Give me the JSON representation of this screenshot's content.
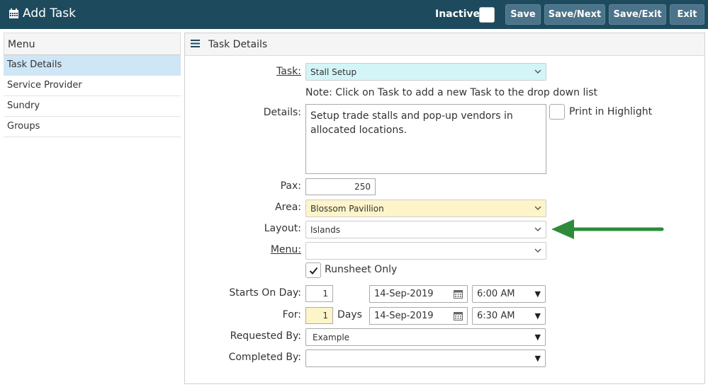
{
  "header": {
    "title": "Add Task",
    "inactive_label": "Inactive",
    "buttons": {
      "save": "Save",
      "save_next": "Save/Next",
      "save_exit": "Save/Exit",
      "exit": "Exit"
    }
  },
  "menu": {
    "header": "Menu",
    "items": [
      {
        "label": "Task Details"
      },
      {
        "label": "Service Provider"
      },
      {
        "label": "Sundry"
      },
      {
        "label": "Groups"
      }
    ]
  },
  "panel": {
    "title": "Task Details",
    "task": {
      "label": "Task:",
      "value": "Stall Setup"
    },
    "note": "Note: Click on Task to add a new Task to the drop down list",
    "details": {
      "label": "Details:",
      "value": "Setup trade stalls and pop-up vendors in allocated locations."
    },
    "print_highlight": "Print in Highlight",
    "pax": {
      "label": "Pax:",
      "value": "250"
    },
    "area": {
      "label": "Area:",
      "value": "Blossom Pavillion"
    },
    "layout": {
      "label": "Layout:",
      "value": "Islands"
    },
    "menu_field": {
      "label": "Menu:",
      "value": ""
    },
    "runsheet_only": "Runsheet Only",
    "starts_on": {
      "label": "Starts On Day:",
      "day": "1",
      "date": "14-Sep-2019",
      "time": "6:00 AM"
    },
    "for": {
      "label": "For:",
      "days_value": "1",
      "days_label": "Days",
      "date": "14-Sep-2019",
      "time": "6:30 AM"
    },
    "requested_by": {
      "label": "Requested By:",
      "value": "Example"
    },
    "completed_by": {
      "label": "Completed By:",
      "value": ""
    }
  },
  "colors": {
    "header_bg": "#1e4a5e",
    "button_bg": "#4b7389",
    "task_select_bg": "#d4f5f7",
    "area_select_bg": "#fdf5c9",
    "menu_active_bg": "#cfe6f7",
    "arrow": "#2e8b3a"
  }
}
